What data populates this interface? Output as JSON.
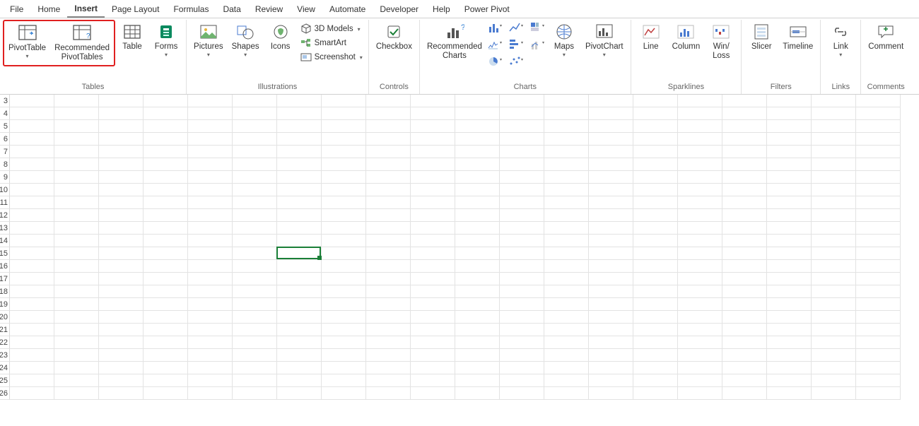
{
  "menubar": {
    "tabs": [
      "File",
      "Home",
      "Insert",
      "Page Layout",
      "Formulas",
      "Data",
      "Review",
      "View",
      "Automate",
      "Developer",
      "Help",
      "Power Pivot"
    ],
    "active_index": 2
  },
  "ribbon": {
    "groups": {
      "tables": {
        "label": "Tables",
        "pivot_table": "PivotTable",
        "recommended_pivot": "Recommended\nPivotTables",
        "table": "Table",
        "forms": "Forms"
      },
      "illustrations": {
        "label": "Illustrations",
        "pictures": "Pictures",
        "shapes": "Shapes",
        "icons": "Icons",
        "models": "3D Models",
        "smartart": "SmartArt",
        "screenshot": "Screenshot"
      },
      "controls": {
        "label": "Controls",
        "checkbox": "Checkbox"
      },
      "charts": {
        "label": "Charts",
        "recommended": "Recommended\nCharts",
        "maps": "Maps",
        "pivotchart": "PivotChart"
      },
      "sparklines": {
        "label": "Sparklines",
        "line": "Line",
        "column": "Column",
        "winloss": "Win/\nLoss"
      },
      "filters": {
        "label": "Filters",
        "slicer": "Slicer",
        "timeline": "Timeline"
      },
      "links": {
        "label": "Links",
        "link": "Link"
      },
      "comments": {
        "label": "Comments",
        "comment": "Comment"
      }
    }
  },
  "sheet": {
    "row_start": 3,
    "row_end": 26,
    "column_count": 20,
    "selected_row": 15,
    "selected_col_index": 6
  }
}
